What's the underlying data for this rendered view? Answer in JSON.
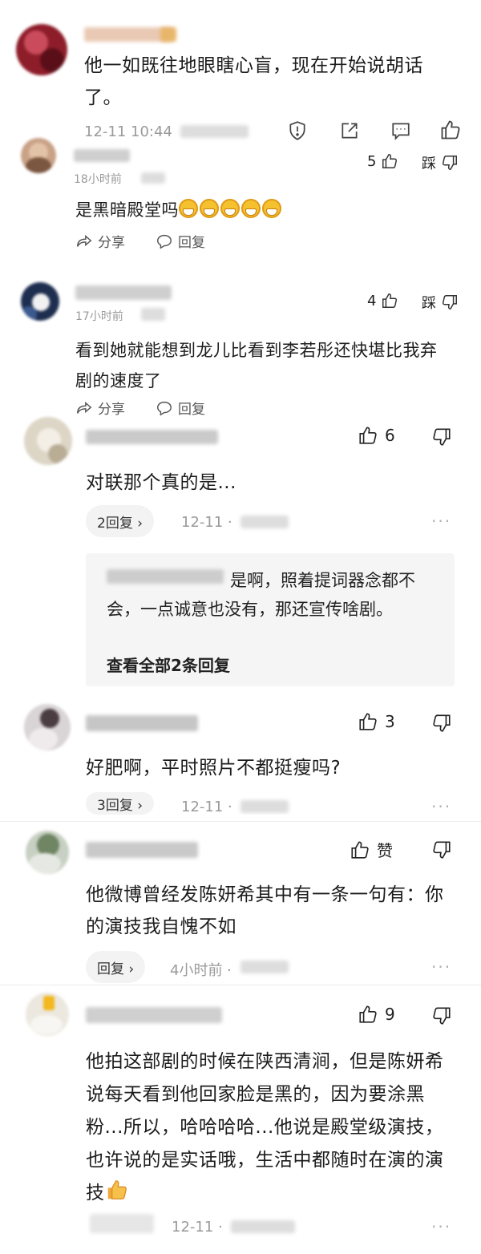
{
  "comments": [
    {
      "text": "他一如既往地眼瞎心盲，现在开始说胡话了。",
      "time": "12-11 10:44"
    },
    {
      "text": "是黑暗殿堂吗",
      "time_prefix": "18小时前",
      "likes": "5",
      "dislike_label": "踩",
      "share_label": "分享",
      "reply_label": "回复"
    },
    {
      "text": "看到她就能想到龙儿比看到李若彤还快堪比我弃剧的速度了",
      "time_prefix": "17小时前",
      "likes": "4",
      "dislike_label": "踩",
      "share_label": "分享",
      "reply_label": "回复"
    },
    {
      "text": "对联那个真的是...",
      "likes": "6",
      "replies_pill": "2回复 ›",
      "time": "12-11 ·",
      "quote_text": "是啊，照着提词器念都不会，一点诚意也没有，那还宣传啥剧。",
      "view_all": "查看全部2条回复"
    },
    {
      "text": "好肥啊，平时照片不都挺瘦吗?",
      "likes": "3",
      "replies_pill": "3回复 ›",
      "time": "12-11 ·"
    },
    {
      "text": "他微博曾经发陈妍希其中有一条一句有：你的演技我自愧不如",
      "likes": "赞",
      "replies_pill": "回复 ›",
      "time": "4小时前 ·"
    },
    {
      "text": "他拍这部剧的时候在陕西清涧，但是陈妍希说每天看到他回家脸是黑的，因为要涂黑粉...所以，哈哈哈哈...他说是殿堂级演技，也许说的是实话哦，生活中都随时在演的演技",
      "likes": "9",
      "time": "12-11 ·"
    }
  ],
  "icons": [
    "report-icon",
    "share-icon",
    "comment-icon",
    "thumb-up-icon",
    "thumb-down-icon",
    "more-icon"
  ],
  "colors": {
    "text": "#1c1c1c",
    "meta": "#9a9a9a",
    "pill_bg": "#f3f3f3",
    "quote_bg": "#f5f5f5"
  }
}
